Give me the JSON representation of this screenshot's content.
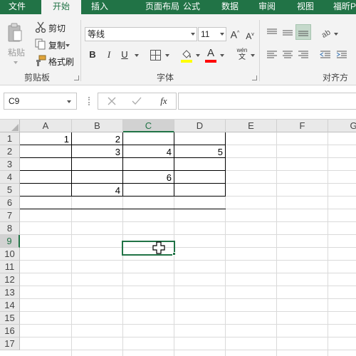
{
  "tabs": [
    {
      "label": "文件",
      "active": false
    },
    {
      "label": "开始",
      "active": true
    },
    {
      "label": "插入",
      "active": false
    },
    {
      "label": "页面布局",
      "active": false
    },
    {
      "label": "公式",
      "active": false
    },
    {
      "label": "数据",
      "active": false
    },
    {
      "label": "审阅",
      "active": false
    },
    {
      "label": "视图",
      "active": false
    },
    {
      "label": "福昕P",
      "active": false
    }
  ],
  "clipboard": {
    "paste": "粘贴",
    "cut": "剪切",
    "copy": "复制",
    "format_painter": "格式刷",
    "group_label": "剪贴板"
  },
  "font": {
    "font_name": "等线",
    "font_size": "11",
    "bold": "B",
    "italic": "I",
    "underline": "U",
    "grow": "A",
    "shrink": "A",
    "font_color_letter": "A",
    "phonetic_top": "wén",
    "phonetic_bottom": "文",
    "group_label": "字体",
    "highlight_color": "#ffff00",
    "font_color": "#ff0000"
  },
  "alignment": {
    "group_label": "对齐方式"
  },
  "formula_bar": {
    "name_box": "C9",
    "fx": "fx",
    "value": ""
  },
  "sheet": {
    "columns": [
      "A",
      "B",
      "C",
      "D",
      "E",
      "F",
      "G"
    ],
    "rows": [
      "1",
      "2",
      "3",
      "4",
      "5",
      "6",
      "7",
      "8",
      "9",
      "10",
      "11",
      "12",
      "13",
      "14",
      "15",
      "16",
      "17"
    ],
    "selected_cell": "C9",
    "cells": {
      "A1": "1",
      "B1": "2",
      "B2": "3",
      "C2": "4",
      "D2": "5",
      "C4": "6",
      "B5": "4"
    },
    "accent": "#217346"
  }
}
